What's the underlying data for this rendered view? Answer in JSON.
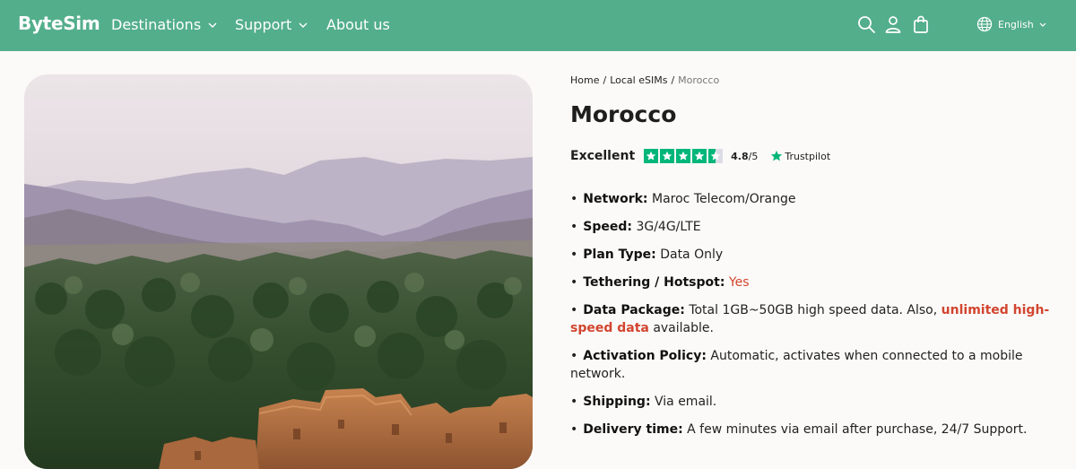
{
  "header": {
    "logo": "ByteSim",
    "nav": [
      "Destinations",
      "Support",
      "About us"
    ],
    "icons": [
      "search-icon",
      "user-icon",
      "bag-icon",
      "globe-icon"
    ],
    "language": "English",
    "background_color": "#53ae8c"
  },
  "breadcrumb": {
    "items": [
      "Home",
      "Local eSIMs",
      "Morocco"
    ],
    "separator": "/"
  },
  "product": {
    "title": "Morocco",
    "rating": {
      "word": "Excellent",
      "stars": 4.5,
      "score": "4.8",
      "out_of": "/5",
      "provider": "Trustpilot",
      "star_color": "#00b67a"
    },
    "features": {
      "network": {
        "label": "Network:",
        "value": "Maroc Telecom/Orange"
      },
      "speed": {
        "label": "Speed:",
        "value": "3G/4G/LTE"
      },
      "plan_type": {
        "label": "Plan Type:",
        "value": "Data Only"
      },
      "tethering": {
        "label": "Tethering / Hotspot:",
        "value": "Yes"
      },
      "data_package": {
        "label": "Data Package:",
        "value_start": "Total 1GB~50GB high speed data. Also,",
        "highlight": "unlimited high-speed data",
        "value_end": "available."
      },
      "activation": {
        "label": "Activation Policy:",
        "value": "Automatic, activates when connected to a mobile network."
      },
      "shipping": {
        "label": "Shipping:",
        "value": "Via email."
      },
      "delivery": {
        "label": "Delivery time:",
        "value": "A few minutes via email after purchase, 24/7 Support."
      }
    },
    "accent_color": "#d2452f"
  }
}
